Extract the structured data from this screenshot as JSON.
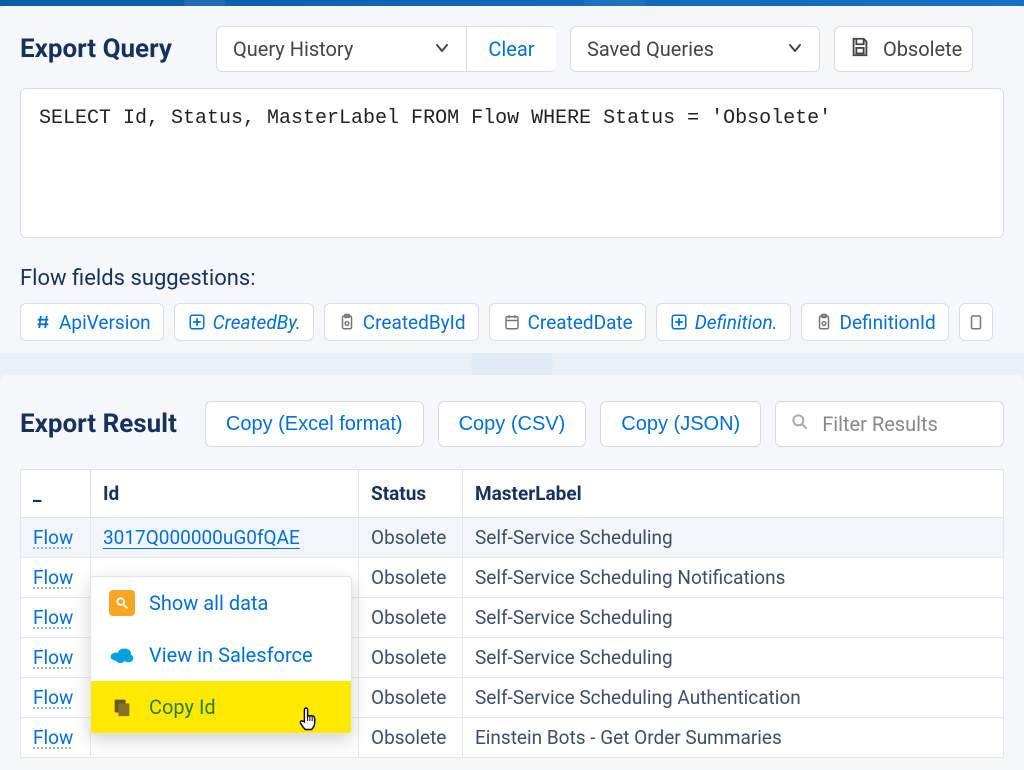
{
  "exportQuery": {
    "title": "Export Query",
    "queryHistoryLabel": "Query History",
    "clearLabel": "Clear",
    "savedQueriesLabel": "Saved Queries",
    "savedQueryName": "Obsolete",
    "queryText": "SELECT Id, Status, MasterLabel FROM Flow WHERE Status = 'Obsolete'",
    "suggestionsLabel": "Flow fields suggestions:",
    "chips": [
      {
        "icon": "hash",
        "label": "ApiVersion",
        "italic": false
      },
      {
        "icon": "add-rel",
        "label": "CreatedBy.",
        "italic": true
      },
      {
        "icon": "clipboard",
        "label": "CreatedById",
        "italic": false
      },
      {
        "icon": "calendar",
        "label": "CreatedDate",
        "italic": false
      },
      {
        "icon": "add-rel",
        "label": "Definition.",
        "italic": true
      },
      {
        "icon": "clipboard",
        "label": "DefinitionId",
        "italic": false
      }
    ]
  },
  "exportResult": {
    "title": "Export Result",
    "copyExcel": "Copy (Excel format)",
    "copyCsv": "Copy (CSV)",
    "copyJson": "Copy (JSON)",
    "filterPlaceholder": "Filter Results",
    "columns": {
      "type": "_",
      "id": "Id",
      "status": "Status",
      "master": "MasterLabel"
    },
    "rows": [
      {
        "type": "Flow",
        "id": "3017Q000000uG0fQAE",
        "status": "Obsolete",
        "master": "Self-Service Scheduling",
        "hover": true
      },
      {
        "type": "Flow",
        "id": "",
        "status": "Obsolete",
        "master": "Self-Service Scheduling Notifications"
      },
      {
        "type": "Flow",
        "id": "",
        "status": "Obsolete",
        "master": "Self-Service Scheduling"
      },
      {
        "type": "Flow",
        "id": "",
        "status": "Obsolete",
        "master": "Self-Service Scheduling"
      },
      {
        "type": "Flow",
        "id": "",
        "status": "Obsolete",
        "master": "Self-Service Scheduling Authentication"
      },
      {
        "type": "Flow",
        "id": "",
        "status": "Obsolete",
        "master": "Einstein Bots - Get Order Summaries"
      }
    ]
  },
  "contextMenu": {
    "showAll": "Show all data",
    "viewInSf": "View in Salesforce",
    "copyId": "Copy Id"
  }
}
